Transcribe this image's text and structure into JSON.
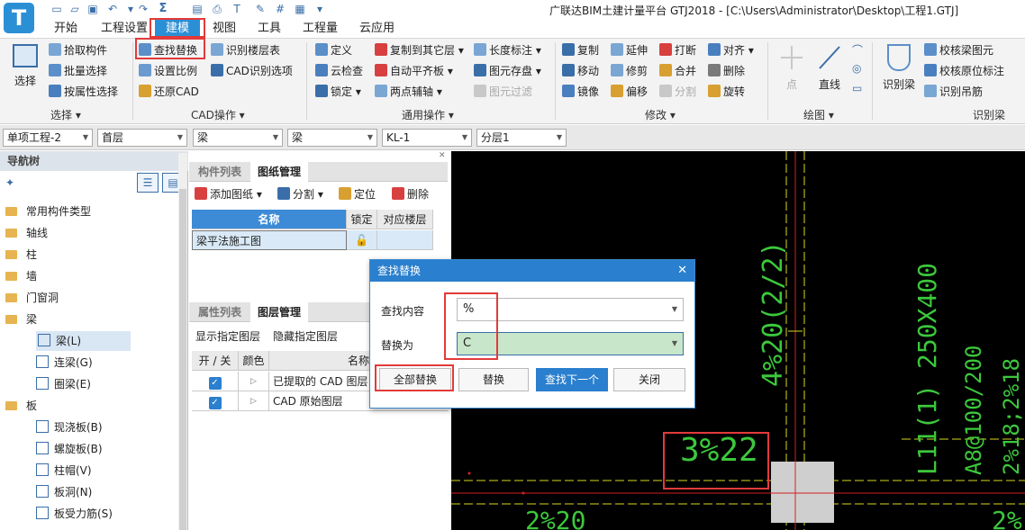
{
  "app": {
    "title": "广联达BIM土建计量平台 GTJ2018 - [C:\\Users\\Administrator\\Desktop\\工程1.GTJ]",
    "logo": "T"
  },
  "menu": [
    "开始",
    "工程设置",
    "建模",
    "视图",
    "工具",
    "工程量",
    "云应用"
  ],
  "ribbon": {
    "select_group": {
      "big": "选择",
      "items": [
        "拾取构件",
        "批量选择",
        "按属性选择"
      ],
      "label": "选择"
    },
    "cad_group": {
      "items": [
        "查找替换",
        "识别楼层表",
        "设置比例",
        "CAD识别选项",
        "还原CAD"
      ],
      "label": "CAD操作"
    },
    "common_group": {
      "items": [
        "定义",
        "复制到其它层",
        "长度标注",
        "云检查",
        "自动平齐板",
        "图元存盘",
        "锁定",
        "两点辅轴",
        "图元过滤"
      ],
      "label": "通用操作"
    },
    "modify_group": {
      "items": [
        "复制",
        "延伸",
        "打断",
        "对齐",
        "移动",
        "修剪",
        "合并",
        "删除",
        "镜像",
        "偏移",
        "分割",
        "旋转"
      ],
      "label": "修改"
    },
    "draw_group": {
      "items": [
        "点",
        "直线"
      ],
      "label": "绘图"
    },
    "recognize_group": {
      "items": [
        "识别梁",
        "校核梁图元",
        "校核原位标注",
        "识别吊筋"
      ],
      "label": "识别梁"
    }
  },
  "selectors": [
    "单项工程-2",
    "首层",
    "梁",
    "梁",
    "KL-1",
    "分层1"
  ],
  "nav": {
    "header": "导航树",
    "items": [
      {
        "label": "常用构件类型",
        "type": "folder"
      },
      {
        "label": "轴线",
        "type": "folder"
      },
      {
        "label": "柱",
        "type": "folder"
      },
      {
        "label": "墙",
        "type": "folder"
      },
      {
        "label": "门窗洞",
        "type": "folder"
      },
      {
        "label": "梁",
        "type": "folder"
      },
      {
        "label": "梁(L)",
        "type": "sub",
        "selected": true
      },
      {
        "label": "连梁(G)",
        "type": "sub"
      },
      {
        "label": "圈梁(E)",
        "type": "sub"
      },
      {
        "label": "板",
        "type": "folder"
      },
      {
        "label": "现浇板(B)",
        "type": "sub"
      },
      {
        "label": "螺旋板(B)",
        "type": "sub"
      },
      {
        "label": "柱帽(V)",
        "type": "sub"
      },
      {
        "label": "板洞(N)",
        "type": "sub"
      },
      {
        "label": "板受力筋(S)",
        "type": "sub"
      }
    ]
  },
  "drawing_panel": {
    "tabs": [
      "构件列表",
      "图纸管理"
    ],
    "toolbar": [
      "添加图纸",
      "分割",
      "定位",
      "删除"
    ],
    "columns": [
      "名称",
      "锁定",
      "对应楼层"
    ],
    "rows": [
      {
        "name": "梁平法施工图",
        "lock": "unlocked",
        "floor": ""
      }
    ]
  },
  "layer_panel": {
    "tabs": [
      "属性列表",
      "图层管理"
    ],
    "toolbar": [
      "显示指定图层",
      "隐藏指定图层"
    ],
    "columns": [
      "开 / 关",
      "颜色",
      "名称"
    ],
    "rows": [
      {
        "checked": true,
        "name": "已提取的 CAD 图层"
      },
      {
        "checked": true,
        "name": "CAD 原始图层"
      }
    ]
  },
  "dialog": {
    "title": "查找替换",
    "find_label": "查找内容",
    "find_value": "%",
    "replace_label": "替换为",
    "replace_value": "C",
    "buttons": [
      "全部替换",
      "替换",
      "查找下一个",
      "关闭"
    ]
  },
  "cad_texts": {
    "vertical_left": "4%20(2/2)",
    "vertical_right_1": "L11(1) 250X400",
    "vertical_right_2": "A8@100/200",
    "vertical_right_3": "2%18;2%18",
    "bottom_label": "3%22",
    "bottom_left": "2%20",
    "bottom_right": "2%"
  },
  "colors": {
    "accent": "#2b8fd6",
    "highlight": "#e23a3a",
    "cad_green": "#3cc83c",
    "cad_yellow": "#d8d820",
    "cad_red": "#d42020"
  }
}
